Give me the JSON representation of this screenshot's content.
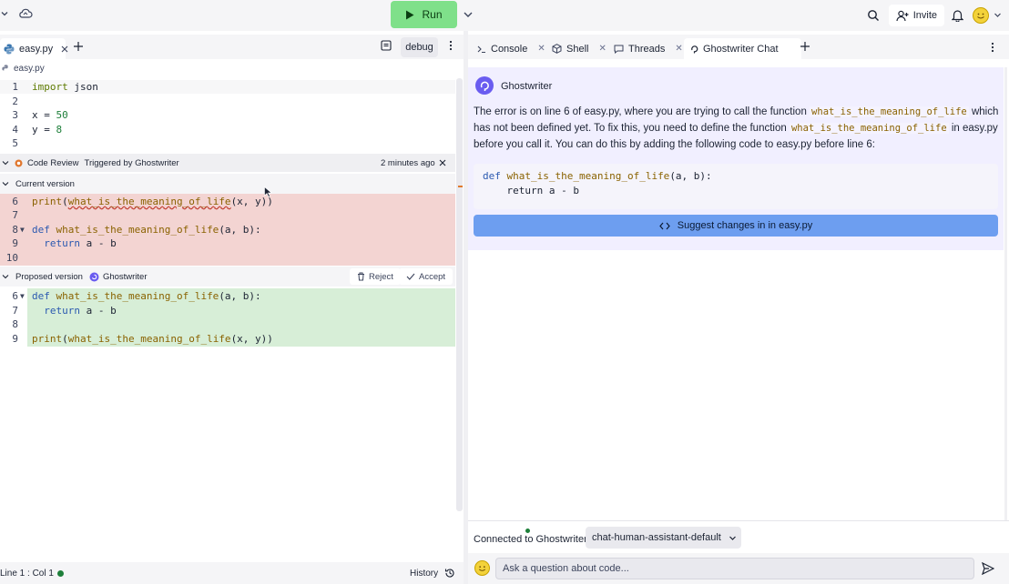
{
  "topbar": {
    "run_label": "Run",
    "invite_label": "Invite"
  },
  "editor": {
    "file_tab": "easy.py",
    "debug_label": "debug",
    "breadcrumb": "easy.py",
    "lines": [
      {
        "n": "1",
        "code": "import json"
      },
      {
        "n": "2",
        "code": ""
      },
      {
        "n": "3",
        "code": "x = 50"
      },
      {
        "n": "4",
        "code": "y = 8"
      },
      {
        "n": "5",
        "code": ""
      }
    ]
  },
  "code_review": {
    "title": "Code Review",
    "trigger": "Triggered by Ghostwriter",
    "time": "2 minutes ago",
    "current_label": "Current version",
    "current_lines": [
      {
        "n": "6",
        "code": "print(what_is_the_meaning_of_life(x, y))"
      },
      {
        "n": "7",
        "code": ""
      },
      {
        "n": "8",
        "code": "def what_is_the_meaning_of_life(a, b):"
      },
      {
        "n": "9",
        "code": "  return a - b"
      },
      {
        "n": "10",
        "code": ""
      }
    ],
    "proposed_label": "Proposed version",
    "proposed_author": "Ghostwriter",
    "reject_label": "Reject",
    "accept_label": "Accept",
    "proposed_lines": [
      {
        "n": "6",
        "code": "def what_is_the_meaning_of_life(a, b):"
      },
      {
        "n": "7",
        "code": "  return a - b"
      },
      {
        "n": "8",
        "code": ""
      },
      {
        "n": "9",
        "code": "print(what_is_the_meaning_of_life(x, y))"
      }
    ]
  },
  "status": {
    "position": "Line 1 : Col 1",
    "history_label": "History"
  },
  "right_tabs": [
    {
      "label": "Console"
    },
    {
      "label": "Shell"
    },
    {
      "label": "Threads"
    },
    {
      "label": "Ghostwriter Chat"
    }
  ],
  "chat": {
    "sender": "Ghostwriter",
    "msg_part1": "The error is on line 6 of easy.py, where you are trying to call the function",
    "msg_code1": "what_is_the_meaning_of_life",
    "msg_part2": "which has not been defined yet. To fix this, you need to define the function",
    "msg_code2": "what_is_the_meaning_of_life",
    "msg_part3": "in easy.py before you call it. You can do this by adding the following code to easy.py before line 6:",
    "code_line1": "def what_is_the_meaning_of_life(a, b):",
    "code_line2": "    return a - b",
    "suggest_label": "Suggest changes in in easy.py",
    "connected_label": "Connected to Ghostwriter",
    "model": "chat-human-assistant-default",
    "input_placeholder": "Ask a question about code..."
  },
  "colors": {
    "run_green": "#7fe08a",
    "removed_bg": "#f3d4d2",
    "added_bg": "#d7eed7",
    "chat_bg": "#f1efff",
    "suggest_blue": "#6d9ef0",
    "ghostwriter_purple": "#6a5cf0"
  }
}
